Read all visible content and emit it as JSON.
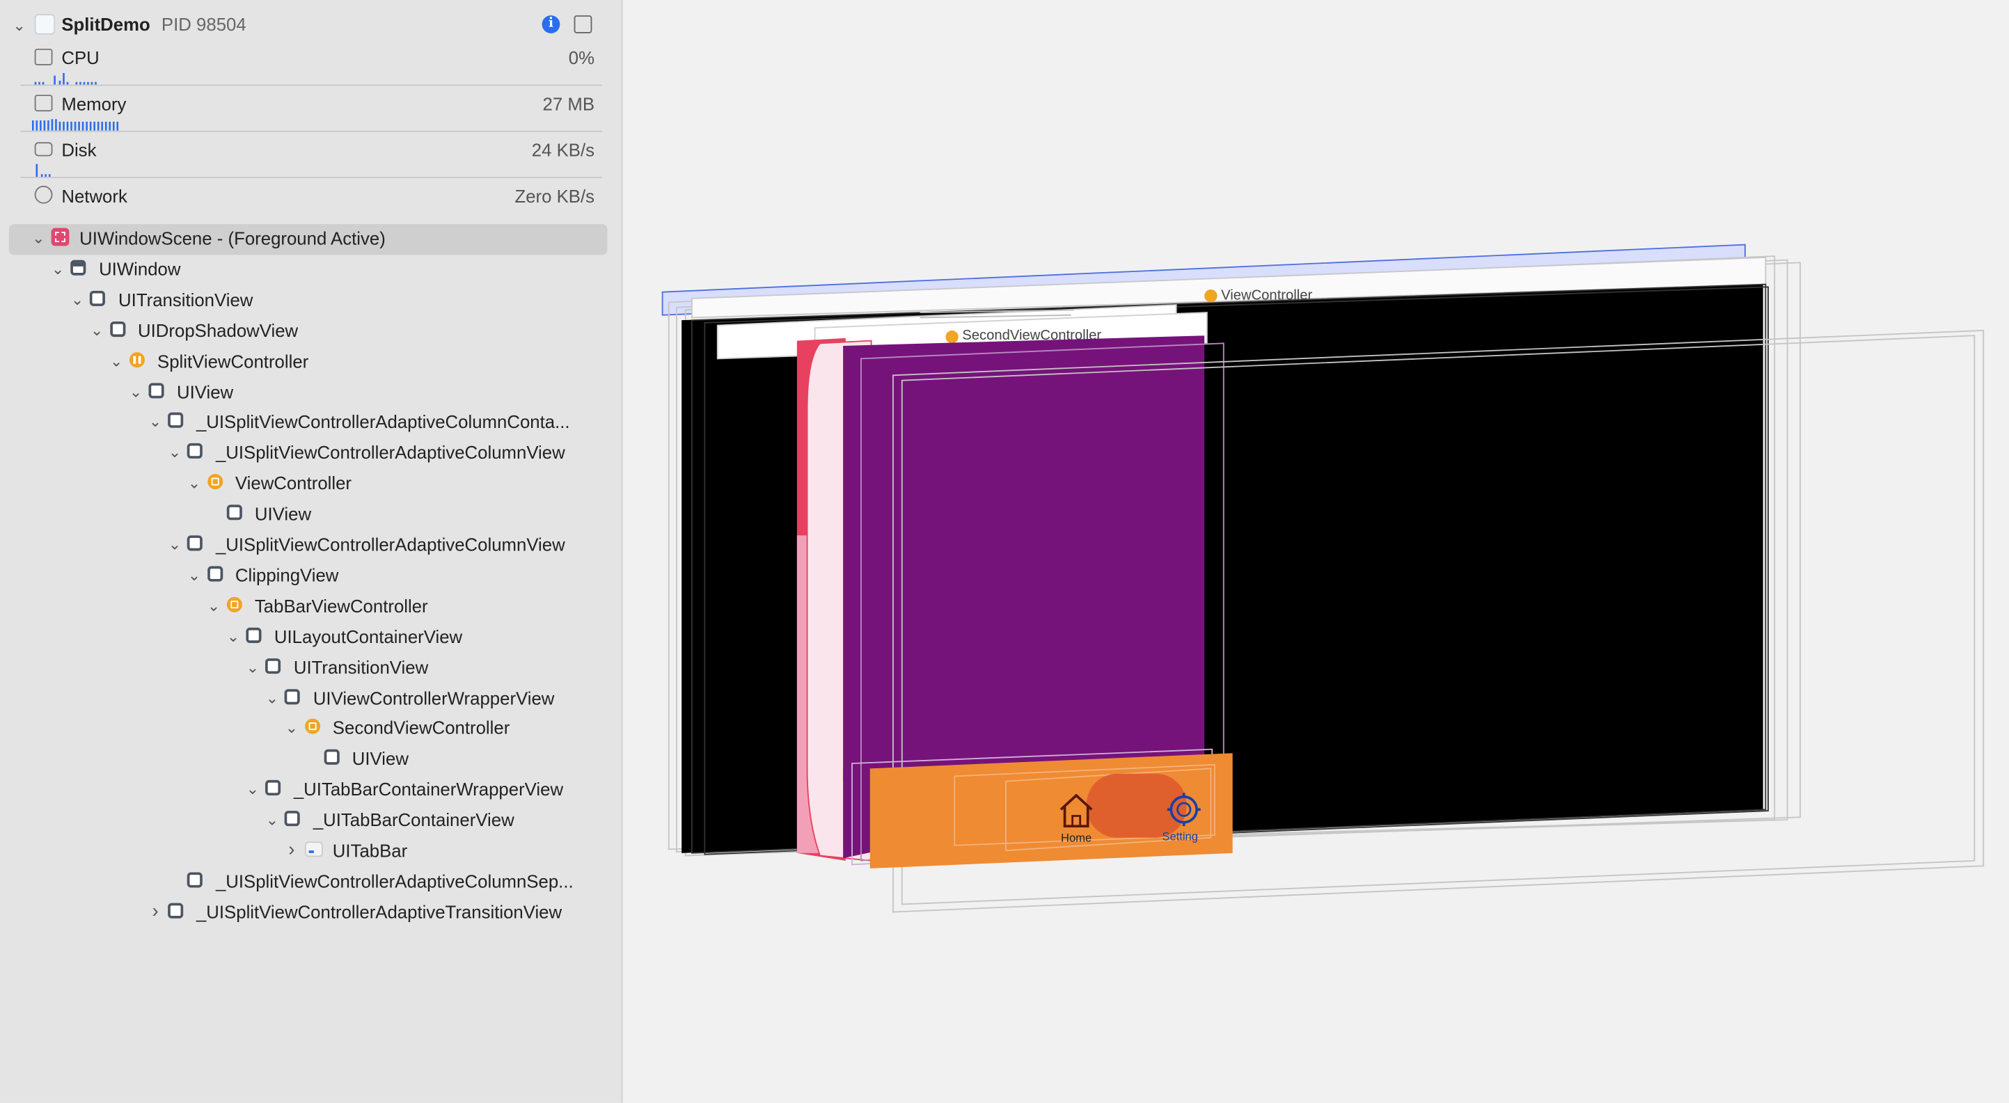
{
  "process": {
    "name": "SplitDemo",
    "pid": "PID 98504"
  },
  "metrics": [
    {
      "label": "CPU",
      "value": "0%",
      "icon": "cpu-icon"
    },
    {
      "label": "Memory",
      "value": "27 MB",
      "icon": "memory-icon"
    },
    {
      "label": "Disk",
      "value": "24 KB/s",
      "icon": "disk-icon"
    },
    {
      "label": "Network",
      "value": "Zero KB/s",
      "icon": "network-icon"
    }
  ],
  "tree": [
    {
      "label": "UIWindowScene - (Foreground Active)",
      "icon": "scene",
      "chev": "down",
      "selected": true
    },
    {
      "label": "UIWindow",
      "icon": "window",
      "chev": "down"
    },
    {
      "label": "UITransitionView",
      "icon": "view",
      "chev": "down"
    },
    {
      "label": "UIDropShadowView",
      "icon": "view",
      "chev": "down"
    },
    {
      "label": "SplitViewController",
      "icon": "split",
      "chev": "down"
    },
    {
      "label": "UIView",
      "icon": "view",
      "chev": "down"
    },
    {
      "label": "_UISplitViewControllerAdaptiveColumnConta...",
      "icon": "view",
      "chev": "down"
    },
    {
      "label": "_UISplitViewControllerAdaptiveColumnView",
      "icon": "view",
      "chev": "down"
    },
    {
      "label": "ViewController",
      "icon": "vc",
      "chev": "down"
    },
    {
      "label": "UIView",
      "icon": "view",
      "chev": "none"
    },
    {
      "label": "_UISplitViewControllerAdaptiveColumnView",
      "icon": "view",
      "chev": "down"
    },
    {
      "label": "ClippingView",
      "icon": "view",
      "chev": "down"
    },
    {
      "label": "TabBarViewController",
      "icon": "vc",
      "chev": "down"
    },
    {
      "label": "UILayoutContainerView",
      "icon": "view",
      "chev": "down"
    },
    {
      "label": "UITransitionView",
      "icon": "view",
      "chev": "down"
    },
    {
      "label": "UIViewControllerWrapperView",
      "icon": "view",
      "chev": "down"
    },
    {
      "label": "SecondViewController",
      "icon": "vc",
      "chev": "down"
    },
    {
      "label": "UIView",
      "icon": "view",
      "chev": "none"
    },
    {
      "label": "_UITabBarContainerWrapperView",
      "icon": "view",
      "chev": "down"
    },
    {
      "label": "_UITabBarContainerView",
      "icon": "view",
      "chev": "down"
    },
    {
      "label": "UITabBar",
      "icon": "tabbar",
      "chev": "right"
    },
    {
      "label": "_UISplitViewControllerAdaptiveColumnSep...",
      "icon": "view",
      "chev": "none"
    },
    {
      "label": "_UISplitViewControllerAdaptiveTransitionView",
      "icon": "view",
      "chev": "right"
    }
  ],
  "scene": {
    "view_controller_label": "ViewController",
    "second_vc_label": "SecondViewController",
    "tab_home": "Home",
    "tab_setting": "Setting",
    "colors": {
      "purple": "#76137a",
      "orange": "#ef8b33",
      "pink": "#e8415f",
      "black": "#000000"
    }
  }
}
